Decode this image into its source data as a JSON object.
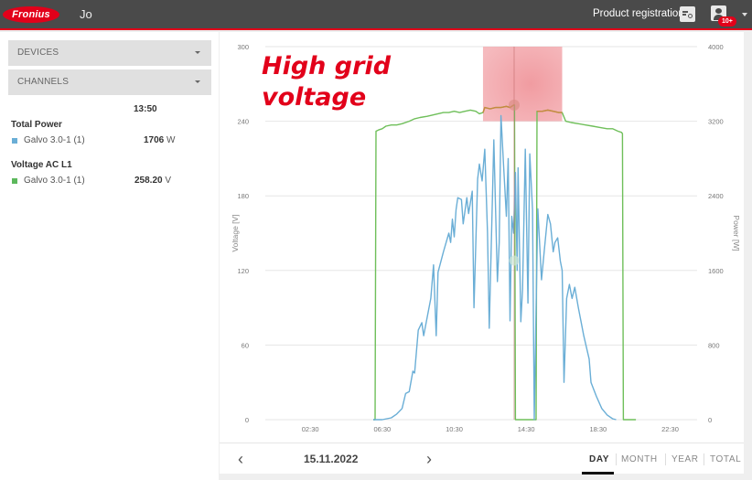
{
  "header": {
    "logo_text": "Fronius",
    "user_initials": "Jo",
    "product_registration_label": "Product registration",
    "notification_badge": "10+"
  },
  "sidebar": {
    "devices_label": "DEVICES",
    "channels_label": "CHANNELS",
    "time": "13:50",
    "sections": [
      {
        "title": "Total Power",
        "series_name": "Galvo 3.0-1 (1)",
        "value": "1706",
        "unit": "W",
        "color": "#6aaed6"
      },
      {
        "title": "Voltage AC L1",
        "series_name": "Galvo 3.0-1 (1)",
        "value": "258.20",
        "unit": "V",
        "color": "#5cb85c"
      }
    ]
  },
  "footer": {
    "prev_label": "‹",
    "next_label": "›",
    "date": "15.11.2022",
    "tabs": [
      {
        "label": "DAY",
        "active": true
      },
      {
        "label": "MONTH",
        "active": false
      },
      {
        "label": "YEAR",
        "active": false
      },
      {
        "label": "TOTAL",
        "active": false
      }
    ]
  },
  "chart_data": {
    "type": "line",
    "title": "",
    "annotation": {
      "text_line1": "High grid",
      "text_line2": "voltage",
      "color": "#e2001a",
      "highlight_x": [
        12.1,
        16.5
      ],
      "highlight_y_voltage": [
        240,
        300
      ]
    },
    "xlabel": "",
    "x_ticks": [
      "02:30",
      "06:30",
      "10:30",
      "14:30",
      "18:30",
      "22:30"
    ],
    "x_tick_hours": [
      2.5,
      6.5,
      10.5,
      14.5,
      18.5,
      22.5
    ],
    "xlim_hours": [
      0,
      24
    ],
    "ylabel_left": "Voltage [V]",
    "ylabel_right": "Power [W]",
    "y_left_ticks": [
      0,
      60,
      120,
      180,
      240,
      300
    ],
    "y_left_lim": [
      0,
      300
    ],
    "y_right_ticks": [
      0,
      800,
      1600,
      2400,
      3200,
      4000
    ],
    "y_right_lim": [
      0,
      4000
    ],
    "grid": true,
    "cursor_hour": 13.83,
    "series": [
      {
        "name": "Voltage AC L1 – Galvo 3.0-1 (1)",
        "axis": "left",
        "color": "#6fbf5a",
        "points": [
          [
            6.0,
            0
          ],
          [
            6.1,
            0
          ],
          [
            6.15,
            232
          ],
          [
            6.3,
            233
          ],
          [
            6.5,
            234
          ],
          [
            6.7,
            236
          ],
          [
            7.0,
            237
          ],
          [
            7.3,
            237
          ],
          [
            7.6,
            238
          ],
          [
            8.0,
            240
          ],
          [
            8.3,
            242
          ],
          [
            8.6,
            243
          ],
          [
            9.0,
            244
          ],
          [
            9.3,
            245
          ],
          [
            9.6,
            246
          ],
          [
            9.9,
            247
          ],
          [
            10.2,
            247
          ],
          [
            10.5,
            248
          ],
          [
            10.8,
            247
          ],
          [
            11.1,
            248
          ],
          [
            11.4,
            249
          ],
          [
            11.7,
            248
          ],
          [
            11.9,
            246
          ],
          [
            12.1,
            247
          ],
          [
            12.2,
            251
          ],
          [
            12.5,
            250
          ],
          [
            12.8,
            251
          ],
          [
            13.1,
            251
          ],
          [
            13.4,
            252
          ],
          [
            13.6,
            251
          ],
          [
            13.8,
            253
          ],
          [
            13.85,
            253
          ],
          [
            13.9,
            0
          ],
          [
            14.9,
            0
          ],
          [
            15.05,
            0
          ],
          [
            15.1,
            248
          ],
          [
            15.4,
            248
          ],
          [
            15.7,
            249
          ],
          [
            16.0,
            248
          ],
          [
            16.3,
            247
          ],
          [
            16.5,
            247
          ],
          [
            16.7,
            240
          ],
          [
            17.0,
            239
          ],
          [
            17.4,
            238
          ],
          [
            17.8,
            237
          ],
          [
            18.2,
            236
          ],
          [
            18.6,
            235
          ],
          [
            19.0,
            234
          ],
          [
            19.3,
            234
          ],
          [
            19.6,
            232
          ],
          [
            19.8,
            231
          ],
          [
            19.85,
            230
          ],
          [
            19.9,
            0
          ],
          [
            20.6,
            0
          ]
        ]
      },
      {
        "name": "Total Power – Galvo 3.0-1 (1)",
        "axis": "right",
        "color": "#6aaed6",
        "points": [
          [
            6.0,
            0
          ],
          [
            6.5,
            0
          ],
          [
            7.0,
            20
          ],
          [
            7.3,
            60
          ],
          [
            7.6,
            120
          ],
          [
            7.8,
            280
          ],
          [
            8.0,
            300
          ],
          [
            8.2,
            520
          ],
          [
            8.3,
            500
          ],
          [
            8.5,
            960
          ],
          [
            8.7,
            1040
          ],
          [
            8.8,
            900
          ],
          [
            9.0,
            1100
          ],
          [
            9.2,
            1300
          ],
          [
            9.35,
            1660
          ],
          [
            9.5,
            900
          ],
          [
            9.6,
            1580
          ],
          [
            9.9,
            1800
          ],
          [
            10.2,
            2000
          ],
          [
            10.3,
            1900
          ],
          [
            10.4,
            2150
          ],
          [
            10.5,
            1960
          ],
          [
            10.6,
            2250
          ],
          [
            10.7,
            2380
          ],
          [
            10.9,
            2360
          ],
          [
            11.0,
            2100
          ],
          [
            11.2,
            2380
          ],
          [
            11.3,
            2210
          ],
          [
            11.5,
            2450
          ],
          [
            11.6,
            1200
          ],
          [
            11.8,
            2580
          ],
          [
            11.9,
            2740
          ],
          [
            12.05,
            2560
          ],
          [
            12.2,
            2900
          ],
          [
            12.35,
            2000
          ],
          [
            12.45,
            980
          ],
          [
            12.7,
            3000
          ],
          [
            12.9,
            1480
          ],
          [
            13.0,
            1900
          ],
          [
            13.1,
            3260
          ],
          [
            13.25,
            2700
          ],
          [
            13.4,
            2180
          ],
          [
            13.5,
            2800
          ],
          [
            13.6,
            1060
          ],
          [
            13.7,
            2180
          ],
          [
            13.8,
            2000
          ],
          [
            13.9,
            2650
          ],
          [
            14.0,
            1600
          ],
          [
            14.05,
            2700
          ],
          [
            14.2,
            1050
          ],
          [
            14.3,
            1400
          ],
          [
            14.45,
            2900
          ],
          [
            14.6,
            1250
          ],
          [
            14.7,
            2850
          ],
          [
            14.85,
            2250
          ],
          [
            14.95,
            0
          ],
          [
            15.05,
            1200
          ],
          [
            15.15,
            2260
          ],
          [
            15.35,
            1500
          ],
          [
            15.55,
            1900
          ],
          [
            15.7,
            2200
          ],
          [
            15.85,
            2100
          ],
          [
            16.0,
            1800
          ],
          [
            16.1,
            1900
          ],
          [
            16.25,
            1950
          ],
          [
            16.4,
            1700
          ],
          [
            16.5,
            1600
          ],
          [
            16.6,
            400
          ],
          [
            16.75,
            1300
          ],
          [
            16.9,
            1450
          ],
          [
            17.05,
            1300
          ],
          [
            17.2,
            1420
          ],
          [
            17.4,
            1200
          ],
          [
            17.7,
            900
          ],
          [
            18.0,
            650
          ],
          [
            18.1,
            400
          ],
          [
            18.4,
            250
          ],
          [
            18.7,
            120
          ],
          [
            19.0,
            50
          ],
          [
            19.3,
            10
          ],
          [
            19.5,
            0
          ]
        ]
      }
    ]
  }
}
